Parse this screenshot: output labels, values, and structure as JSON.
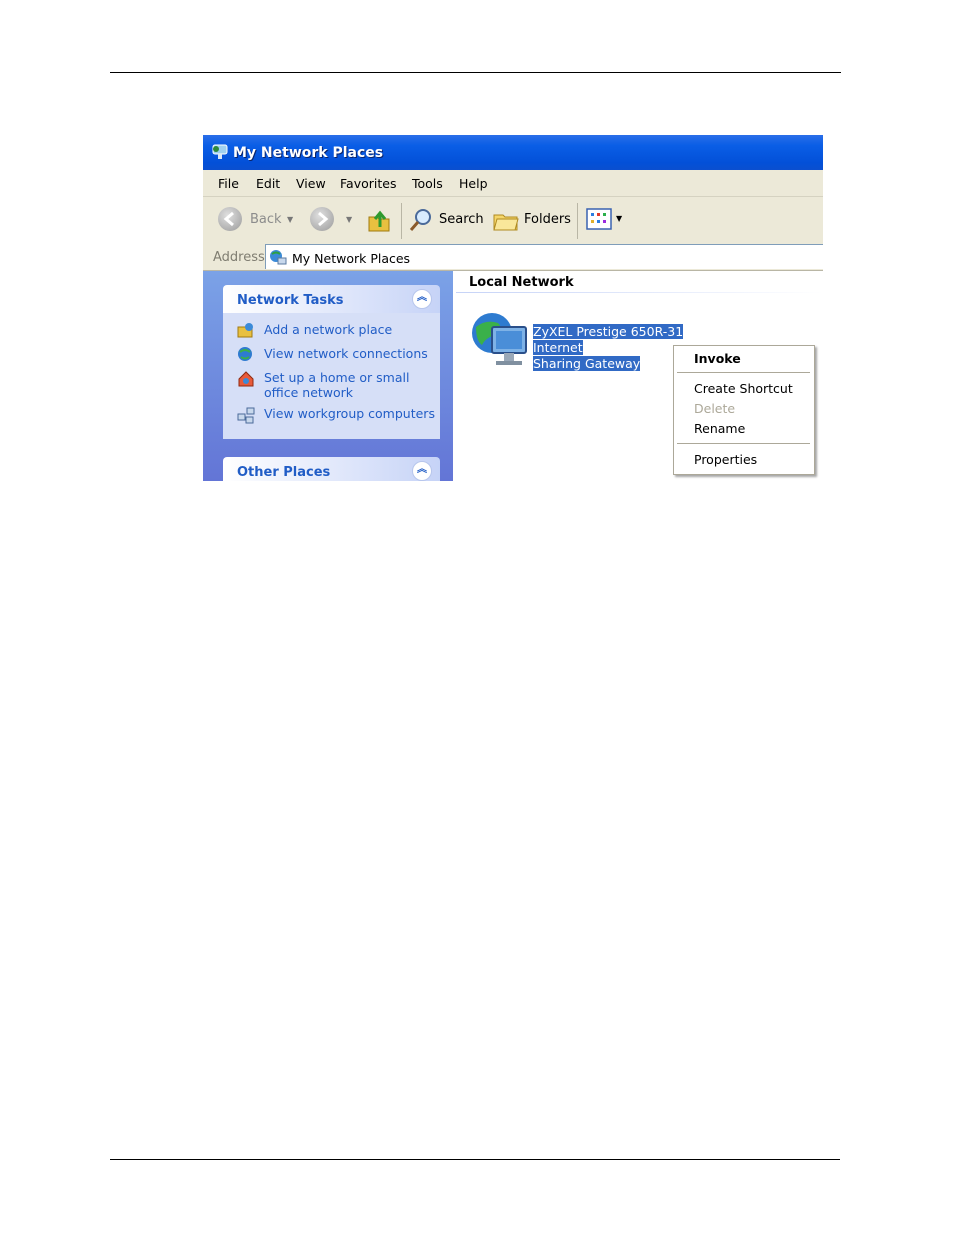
{
  "window": {
    "title": "My Network Places"
  },
  "menubar": [
    "File",
    "Edit",
    "View",
    "Favorites",
    "Tools",
    "Help"
  ],
  "toolbar": {
    "back": "Back",
    "search": "Search",
    "folders": "Folders"
  },
  "address": {
    "label": "Address",
    "value": "My Network Places"
  },
  "network_tasks": {
    "title": "Network Tasks",
    "items": [
      {
        "label": "Add a network place",
        "icon": "add-network-place-icon"
      },
      {
        "label": "View network connections",
        "icon": "network-connections-icon"
      },
      {
        "label_line1": "Set up a home or small",
        "label_line2": "office network",
        "icon": "home-network-setup-icon"
      },
      {
        "label": "View workgroup computers",
        "icon": "workgroup-computers-icon"
      }
    ]
  },
  "other_places": {
    "title": "Other Places"
  },
  "local_network": {
    "title": "Local Network",
    "item_line1": "ZyXEL Prestige 650R-31 Internet",
    "item_line2": "Sharing Gateway"
  },
  "context_menu": {
    "invoke": "Invoke",
    "create_shortcut": "Create Shortcut",
    "delete": "Delete",
    "rename": "Rename",
    "properties": "Properties"
  },
  "colors": {
    "titlebar": "#0a5ee6",
    "link": "#215dc6",
    "selection": "#316ac5",
    "chrome": "#ece9d8"
  }
}
